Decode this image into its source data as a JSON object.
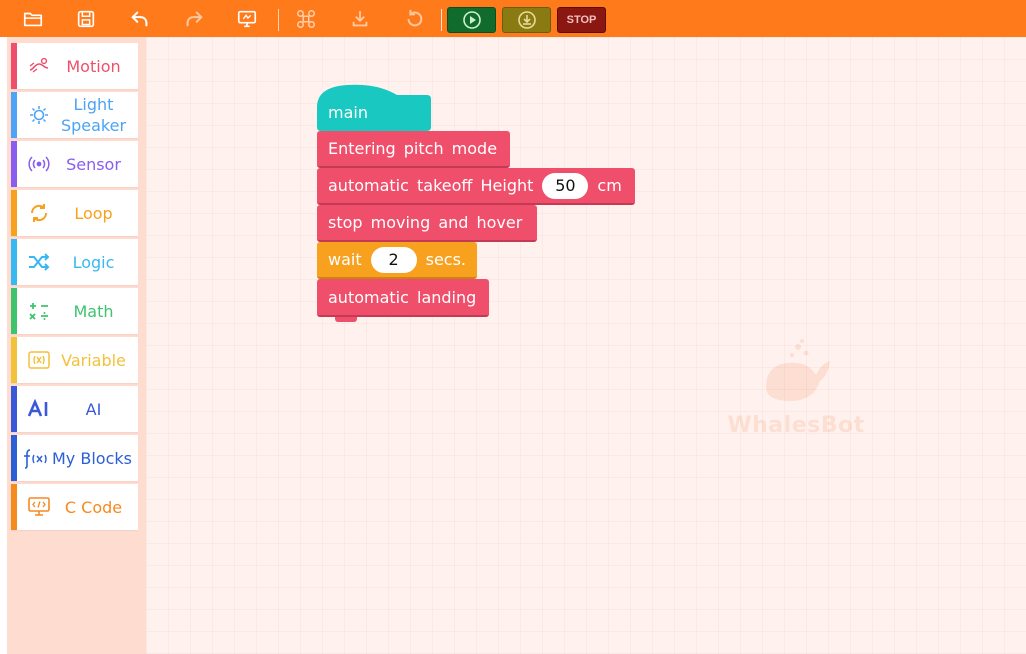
{
  "toolbar": {
    "icons": [
      "folder-open-icon",
      "save-icon",
      "undo-icon",
      "redo-icon",
      "screen-code-icon",
      "drone-icon",
      "upload-icon",
      "reset-icon"
    ],
    "play_icon": "play-circle-icon",
    "download_icon": "download-circle-icon",
    "stop_label": "STOP"
  },
  "sidebar": {
    "categories": [
      {
        "label": "Motion",
        "icon": "motion-icon",
        "color": "#f04f6c"
      },
      {
        "label": "Light\nSpeaker",
        "icon": "light-speaker-icon",
        "color": "#4da3f5"
      },
      {
        "label": "Sensor",
        "icon": "sensor-icon",
        "color": "#8a5cf0"
      },
      {
        "label": "Loop",
        "icon": "loop-icon",
        "color": "#f7a11f"
      },
      {
        "label": "Logic",
        "icon": "logic-icon",
        "color": "#36b9f0"
      },
      {
        "label": "Math",
        "icon": "math-icon",
        "color": "#3ec46d"
      },
      {
        "label": "Variable",
        "icon": "variable-icon",
        "color": "#f2c23a"
      },
      {
        "label": "AI",
        "icon": "ai-icon",
        "color": "#3a59d9"
      },
      {
        "label": "My Blocks",
        "icon": "function-icon",
        "color": "#2c5fd6"
      },
      {
        "label": "C Code",
        "icon": "c-code-icon",
        "color": "#f58a1f"
      }
    ]
  },
  "workspace": {
    "hat_block": {
      "label": "main",
      "color": "#19c8c0"
    },
    "blocks": [
      {
        "text": "Entering pitch mode",
        "color": "red"
      },
      {
        "prefix": "automatic takeoff Height",
        "value": "50",
        "suffix": "cm",
        "color": "red"
      },
      {
        "text": "stop moving and hover",
        "color": "red"
      },
      {
        "prefix": "wait",
        "value": "2",
        "suffix": "secs.",
        "color": "orange"
      },
      {
        "text": "automatic landing",
        "color": "red"
      }
    ],
    "watermark": "WhalesBot"
  }
}
